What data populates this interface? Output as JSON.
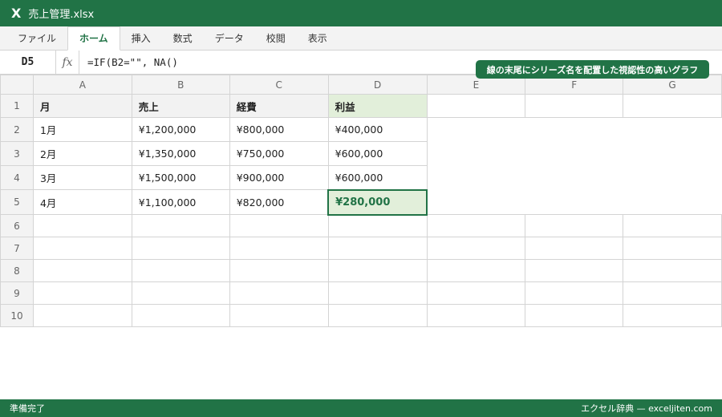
{
  "app": {
    "icon_glyph": "X",
    "title": "売上管理.xlsx"
  },
  "ribbon": {
    "tabs": [
      "ファイル",
      "ホーム",
      "挿入",
      "数式",
      "データ",
      "校閲",
      "表示"
    ],
    "active_tab": "ホーム"
  },
  "formula_bar": {
    "name_box": "D5",
    "fx_label": "fx",
    "formula": "=IF(B2=\"\", NA()"
  },
  "callout": "線の末尾にシリーズ名を配置した視認性の高いグラフ",
  "sheet": {
    "columns": [
      "A",
      "B",
      "C",
      "D",
      "E",
      "F",
      "G"
    ],
    "rows": [
      "1",
      "2",
      "3",
      "4",
      "5",
      "6",
      "7",
      "8",
      "9",
      "10"
    ],
    "header": [
      "月",
      "売上",
      "経費",
      "利益"
    ],
    "data": [
      [
        "1月",
        "¥1,200,000",
        "¥800,000",
        "¥400,000"
      ],
      [
        "2月",
        "¥1,350,000",
        "¥750,000",
        "¥600,000"
      ],
      [
        "3月",
        "¥1,500,000",
        "¥900,000",
        "¥600,000"
      ],
      [
        "4月",
        "¥1,100,000",
        "¥820,000",
        "¥280,000"
      ]
    ],
    "selected_cell": "D5"
  },
  "status": {
    "left": "準備完了",
    "right": "エクセル辞典 — exceljiten.com"
  },
  "colors": {
    "brand": "#217346",
    "header_fill": "#f2f2f2",
    "accent_fill": "#e2efda"
  }
}
